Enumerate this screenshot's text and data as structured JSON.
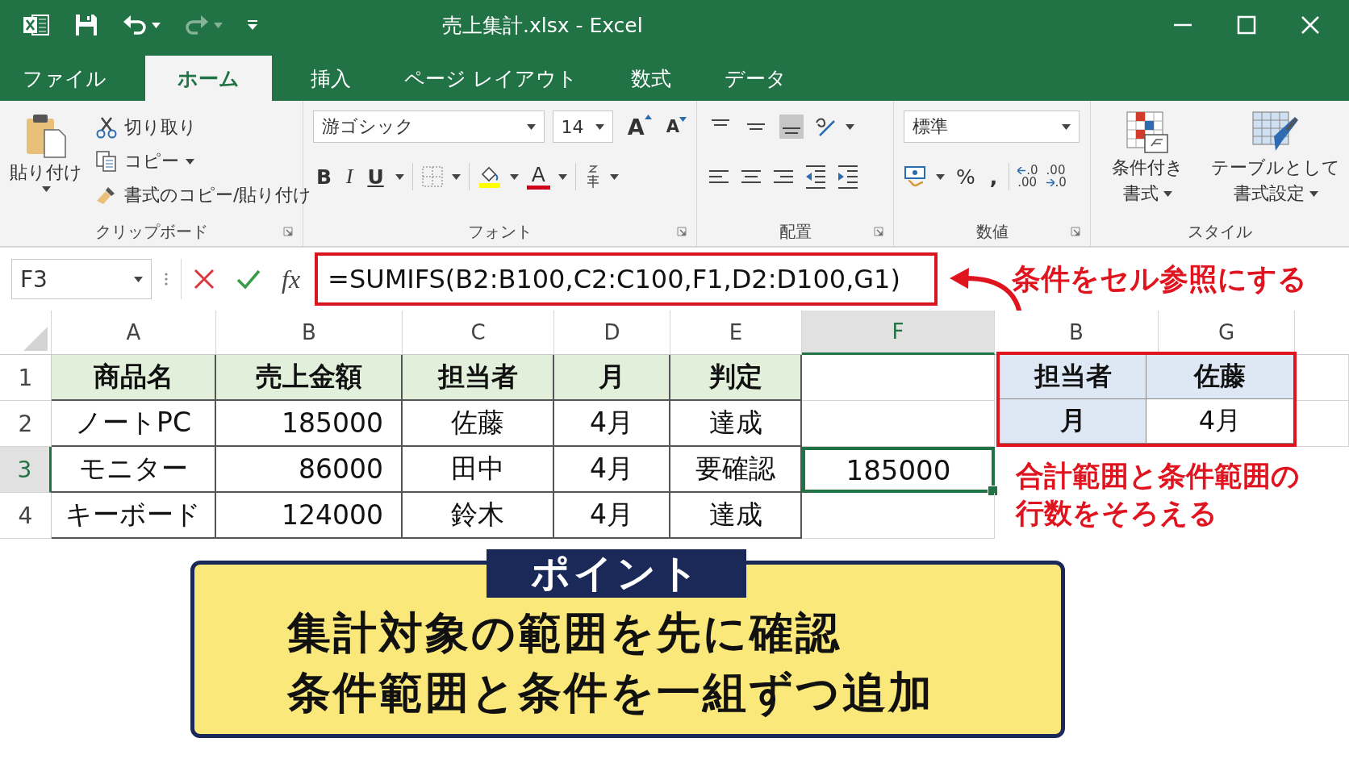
{
  "title_bar": {
    "title": "売上集計.xlsx  -  Excel"
  },
  "tabs": [
    {
      "label": "ファイル",
      "selected": false
    },
    {
      "label": "ホーム",
      "selected": true
    },
    {
      "label": "挿入",
      "selected": false
    },
    {
      "label": "ページ レイアウト",
      "selected": false
    },
    {
      "label": "数式",
      "selected": false
    },
    {
      "label": "データ",
      "selected": false
    }
  ],
  "ribbon": {
    "groups": [
      {
        "kind": "clipboard",
        "label": "クリップボード",
        "paste": "貼り付け",
        "commands": [
          "切り取り",
          "コピー",
          "書式のコピー/貼り付け"
        ]
      },
      {
        "kind": "font",
        "label": "フォント",
        "font_name": "游ゴシック",
        "font_size": "14",
        "grow": "A",
        "shrink": "A",
        "bold": "B",
        "italic": "I",
        "underline": "U",
        "font_color": "A"
      },
      {
        "kind": "alignment",
        "label": "配置",
        "vertical_align": [
          {
            "selected": false
          },
          {
            "selected": false
          },
          {
            "selected": true
          }
        ]
      },
      {
        "kind": "number",
        "label": "数値",
        "format": "標準",
        "percent": "%",
        "comma": ",",
        "increase_decimal": {
          "top": ".0",
          "bottom": ".00"
        },
        "decrease_decimal": {
          "top": ".00",
          "bottom": ".0"
        }
      },
      {
        "kind": "styles",
        "label": "スタイル",
        "buttons": [
          {
            "lines": [
              "条件付き",
              "書式"
            ]
          },
          {
            "lines": [
              "テーブルとして",
              "書式設定"
            ]
          }
        ]
      }
    ]
  },
  "formula_bar": {
    "name_box": "F3",
    "function_label": "fx",
    "formula": "=SUMIFS(B2:B100,C2:C100,F1,D2:D100,G1)",
    "callout": "条件をセル参照にする"
  },
  "sheet": {
    "columns": [
      {
        "label": "A",
        "selected": false
      },
      {
        "label": "B",
        "selected": false
      },
      {
        "label": "C",
        "selected": false
      },
      {
        "label": "D",
        "selected": false
      },
      {
        "label": "E",
        "selected": false
      },
      {
        "label": "F",
        "selected": true
      },
      {
        "label": "B",
        "selected": false
      },
      {
        "label": "G",
        "selected": false
      }
    ],
    "rows": [
      {
        "header": "1",
        "selected": false,
        "kind": "header",
        "cells": [
          "商品名",
          "売上金額",
          "担当者",
          "月",
          "判定"
        ]
      },
      {
        "header": "2",
        "selected": false,
        "kind": "data",
        "cells": [
          "ノートPC",
          "185000",
          "佐藤",
          "4月",
          "達成"
        ]
      },
      {
        "header": "3",
        "selected": true,
        "kind": "data",
        "cells": [
          "モニター",
          "86000",
          "田中",
          "4月",
          "要確認"
        ],
        "column_f": {
          "value": "185000",
          "active": true
        }
      },
      {
        "header": "4",
        "selected": false,
        "kind": "data",
        "cells": [
          "キーボード",
          "124000",
          "鈴木",
          "4月",
          "達成"
        ]
      }
    ],
    "criteria": [
      [
        {
          "text": "担当者",
          "kind": "header"
        },
        {
          "text": "佐藤",
          "kind": "header"
        }
      ],
      [
        {
          "text": "月",
          "kind": "header"
        },
        {
          "text": "4月",
          "kind": "value"
        }
      ]
    ],
    "note": [
      "合計範囲と条件範囲の",
      "行数をそろえる"
    ]
  },
  "point": {
    "label": "ポイント",
    "lines": [
      "集計対象の範囲を先に確認",
      "条件範囲と条件を一組ずつ追加"
    ]
  }
}
